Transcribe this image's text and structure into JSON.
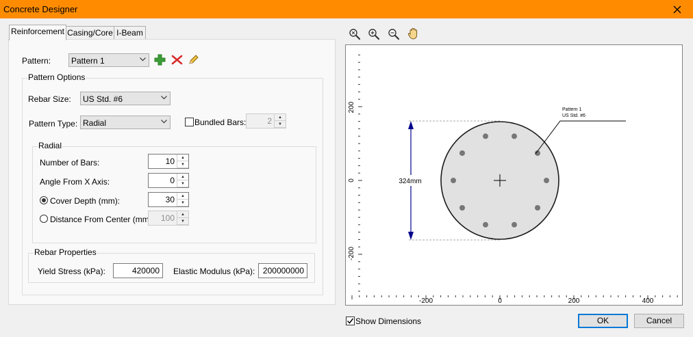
{
  "window": {
    "title": "Concrete Designer",
    "close_icon": "close-icon"
  },
  "tabs": [
    {
      "label": "Reinforcement",
      "active": true
    },
    {
      "label": "Casing/Core",
      "active": false
    },
    {
      "label": "I-Beam",
      "active": false
    }
  ],
  "pattern": {
    "label": "Pattern:",
    "value": "Pattern 1"
  },
  "pattern_options": {
    "title": "Pattern Options",
    "rebar_size_label": "Rebar Size:",
    "rebar_size_value": "US Std. #6",
    "pattern_type_label": "Pattern Type:",
    "pattern_type_value": "Radial",
    "bundled_bars_label": "Bundled Bars:",
    "bundled_bars_checked": false,
    "bundled_bars_value": "2"
  },
  "radial": {
    "title": "Radial",
    "num_bars_label": "Number of Bars:",
    "num_bars_value": "10",
    "angle_label": "Angle From X Axis:",
    "angle_value": "0",
    "cover_label": "Cover Depth (mm):",
    "cover_value": "30",
    "cover_selected": true,
    "distance_label": "Distance From Center (mm):",
    "distance_value": "100",
    "distance_selected": false
  },
  "rebar_properties": {
    "title": "Rebar Properties",
    "yield_label": "Yield Stress (kPa):",
    "yield_value": "420000",
    "elastic_label": "Elastic Modulus (kPa):",
    "elastic_value": "200000000"
  },
  "plot": {
    "x_ticks": [
      "-200",
      "0",
      "200",
      "400"
    ],
    "y_ticks": [
      "200",
      "0",
      "-200"
    ],
    "dimension_label": "324mm",
    "callout_line1": "Pattern 1",
    "callout_line2": "US Std. #6",
    "bar_count": 10
  },
  "footer": {
    "show_dimensions_label": "Show Dimensions",
    "show_dimensions_checked": true,
    "ok_label": "OK",
    "cancel_label": "Cancel"
  },
  "colors": {
    "titlebar": "#ff8c00",
    "dimension": "#00008b",
    "accent": "#0078d7",
    "add_icon": "#3a9e35",
    "delete_icon": "#d92b2b"
  }
}
